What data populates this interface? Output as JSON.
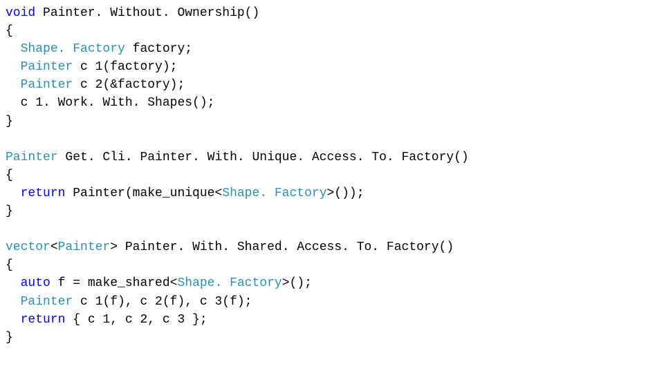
{
  "code": {
    "lines": [
      [
        {
          "cls": "kw",
          "t": "void"
        },
        {
          "cls": "txt",
          "t": " Painter. Without. Ownership()"
        }
      ],
      [
        {
          "cls": "txt",
          "t": "{"
        }
      ],
      [
        {
          "cls": "txt",
          "t": "  "
        },
        {
          "cls": "type",
          "t": "Shape. Factory"
        },
        {
          "cls": "txt",
          "t": " factory;"
        }
      ],
      [
        {
          "cls": "txt",
          "t": "  "
        },
        {
          "cls": "type",
          "t": "Painter"
        },
        {
          "cls": "txt",
          "t": " c 1(factory);"
        }
      ],
      [
        {
          "cls": "txt",
          "t": "  "
        },
        {
          "cls": "type",
          "t": "Painter"
        },
        {
          "cls": "txt",
          "t": " c 2(&factory);"
        }
      ],
      [
        {
          "cls": "txt",
          "t": "  c 1. Work. With. Shapes();"
        }
      ],
      [
        {
          "cls": "txt",
          "t": "}"
        }
      ],
      [
        {
          "cls": "txt",
          "t": ""
        }
      ],
      [
        {
          "cls": "type",
          "t": "Painter"
        },
        {
          "cls": "txt",
          "t": " Get. Cli. Painter. With. Unique. Access. To. Factory()"
        }
      ],
      [
        {
          "cls": "txt",
          "t": "{"
        }
      ],
      [
        {
          "cls": "txt",
          "t": "  "
        },
        {
          "cls": "kw",
          "t": "return"
        },
        {
          "cls": "txt",
          "t": " Painter(make_unique<"
        },
        {
          "cls": "type",
          "t": "Shape. Factory"
        },
        {
          "cls": "txt",
          "t": ">());"
        }
      ],
      [
        {
          "cls": "txt",
          "t": "}"
        }
      ],
      [
        {
          "cls": "txt",
          "t": ""
        }
      ],
      [
        {
          "cls": "type",
          "t": "vector"
        },
        {
          "cls": "txt",
          "t": "<"
        },
        {
          "cls": "type",
          "t": "Painter"
        },
        {
          "cls": "txt",
          "t": "> Painter. With. Shared. Access. To. Factory()"
        }
      ],
      [
        {
          "cls": "txt",
          "t": "{"
        }
      ],
      [
        {
          "cls": "txt",
          "t": "  "
        },
        {
          "cls": "kw",
          "t": "auto"
        },
        {
          "cls": "txt",
          "t": " f = make_shared<"
        },
        {
          "cls": "type",
          "t": "Shape. Factory"
        },
        {
          "cls": "txt",
          "t": ">();"
        }
      ],
      [
        {
          "cls": "txt",
          "t": "  "
        },
        {
          "cls": "type",
          "t": "Painter"
        },
        {
          "cls": "txt",
          "t": " c 1(f), c 2(f), c 3(f);"
        }
      ],
      [
        {
          "cls": "txt",
          "t": "  "
        },
        {
          "cls": "kw",
          "t": "return"
        },
        {
          "cls": "txt",
          "t": " { c 1, c 2, c 3 };"
        }
      ],
      [
        {
          "cls": "txt",
          "t": "}"
        }
      ]
    ]
  }
}
